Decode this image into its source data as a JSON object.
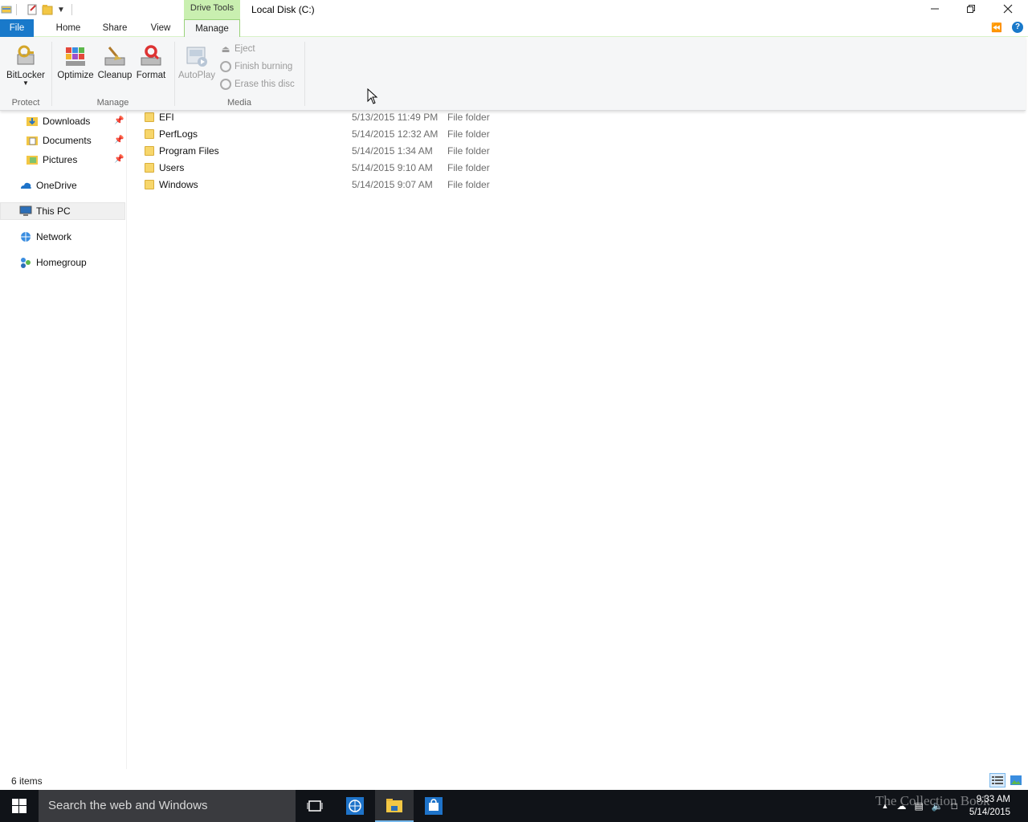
{
  "window": {
    "title": "Local Disk (C:)",
    "context_tab_group": "Drive Tools"
  },
  "ribbon_tabs": {
    "file": "File",
    "home": "Home",
    "share": "Share",
    "view": "View",
    "manage": "Manage"
  },
  "ribbon": {
    "bitlocker": "BitLocker",
    "optimize": "Optimize",
    "cleanup": "Cleanup",
    "format": "Format",
    "autoplay": "AutoPlay",
    "eject": "Eject",
    "finish_burning": "Finish burning",
    "erase_disc": "Erase this disc",
    "groups": {
      "protect": "Protect",
      "manage": "Manage",
      "media": "Media"
    }
  },
  "nav": {
    "downloads": "Downloads",
    "documents": "Documents",
    "pictures": "Pictures",
    "onedrive": "OneDrive",
    "this_pc": "This PC",
    "network": "Network",
    "homegroup": "Homegroup"
  },
  "files": [
    {
      "name": "EFI",
      "date": "5/13/2015 11:49 PM",
      "type": "File folder"
    },
    {
      "name": "PerfLogs",
      "date": "5/14/2015 12:32 AM",
      "type": "File folder"
    },
    {
      "name": "Program Files",
      "date": "5/14/2015 1:34 AM",
      "type": "File folder"
    },
    {
      "name": "Users",
      "date": "5/14/2015 9:10 AM",
      "type": "File folder"
    },
    {
      "name": "Windows",
      "date": "5/14/2015 9:07 AM",
      "type": "File folder"
    }
  ],
  "status": {
    "item_count": "6 items"
  },
  "taskbar": {
    "search_placeholder": "Search the web and Windows",
    "time": "9:33 AM",
    "date": "5/14/2015",
    "watermark": "The Collection Book"
  },
  "colors": {
    "file_tab": "#1979ca",
    "context_tab": "#c9efb0",
    "taskbar": "#101318"
  }
}
